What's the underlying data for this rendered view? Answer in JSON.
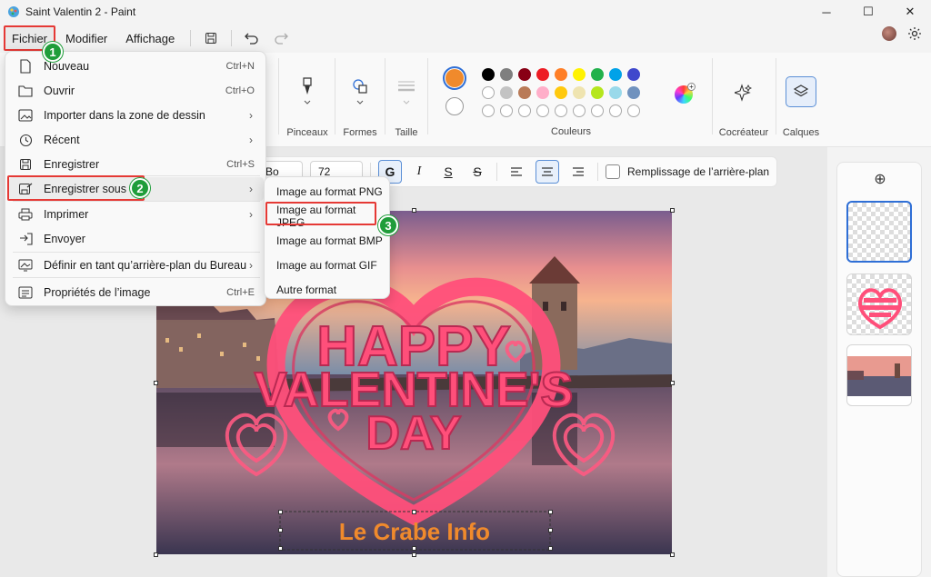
{
  "window": {
    "title": "Saint Valentin 2 - Paint",
    "minimize": "─",
    "maximize": "☐",
    "close": "✕"
  },
  "menubar": {
    "items": [
      "Fichier",
      "Modifier",
      "Affichage"
    ]
  },
  "ribbon": {
    "groups": {
      "brushes": "Pinceaux",
      "shapes": "Formes",
      "size": "Taille",
      "colors": "Couleurs",
      "cocreator": "Cocréateur",
      "layers": "Calques"
    },
    "primary_color": "#f08a2c",
    "secondary_color": "#ffffff",
    "palette": [
      "#000000",
      "#7f7f7f",
      "#880015",
      "#ed1c24",
      "#ff7f27",
      "#fff200",
      "#22b14c",
      "#00a2e8",
      "#3f48cc",
      "#a349a4",
      "#ffffff",
      "#c3c3c3",
      "#b97a57",
      "#ffaec9",
      "#ffc90e",
      "#efe4b0",
      "#b5e61d",
      "#99d9ea",
      "#7092be",
      "#c8bfe7"
    ]
  },
  "text_toolbar": {
    "font": "Bo",
    "size": "72",
    "bold": "G",
    "italic": "I",
    "underline": "S",
    "strike": "S",
    "fill_background": "Remplissage de l’arrière-plan"
  },
  "file_menu": {
    "items": [
      {
        "label": "Nouveau",
        "shortcut": "Ctrl+N",
        "icon": "new-file-icon"
      },
      {
        "label": "Ouvrir",
        "shortcut": "Ctrl+O",
        "icon": "folder-open-icon"
      },
      {
        "label": "Importer dans la zone de dessin",
        "arrow": "›",
        "icon": "import-image-icon"
      },
      {
        "label": "Récent",
        "arrow": "›",
        "icon": "clock-icon"
      },
      {
        "label": "Enregistrer",
        "shortcut": "Ctrl+S",
        "icon": "save-icon"
      },
      {
        "label": "Enregistrer sous",
        "arrow": "›",
        "icon": "save-as-icon"
      },
      {
        "label": "Imprimer",
        "arrow": "›",
        "icon": "printer-icon"
      },
      {
        "label": "Envoyer",
        "icon": "send-icon"
      },
      {
        "label": "Définir en tant qu’arrière-plan du Bureau",
        "arrow": "›",
        "icon": "desktop-background-icon"
      },
      {
        "label": "Propriétés de l’image",
        "shortcut": "Ctrl+E",
        "icon": "image-properties-icon"
      }
    ]
  },
  "save_as_submenu": {
    "items": [
      "Image au format PNG",
      "Image au format JPEG",
      "Image au format BMP",
      "Image au format GIF",
      "Autre format"
    ]
  },
  "canvas": {
    "headline_1": "HAPPY",
    "headline_2": "VALENTINE'S",
    "headline_3": "DAY",
    "watermark": "Le Crabe Info"
  },
  "layers_panel": {
    "add": "⊕"
  },
  "steps": [
    "1",
    "2",
    "3"
  ]
}
